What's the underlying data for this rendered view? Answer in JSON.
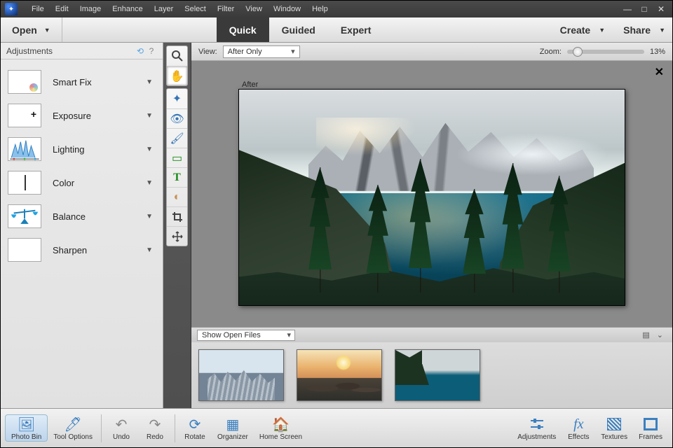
{
  "menu": {
    "items": [
      "File",
      "Edit",
      "Image",
      "Enhance",
      "Layer",
      "Select",
      "Filter",
      "View",
      "Window",
      "Help"
    ]
  },
  "topbar": {
    "open_label": "Open",
    "modes": {
      "quick": "Quick",
      "guided": "Guided",
      "expert": "Expert"
    },
    "create_label": "Create",
    "share_label": "Share"
  },
  "adjustments": {
    "title": "Adjustments",
    "items": [
      {
        "label": "Smart Fix"
      },
      {
        "label": "Exposure"
      },
      {
        "label": "Lighting"
      },
      {
        "label": "Color"
      },
      {
        "label": "Balance"
      },
      {
        "label": "Sharpen"
      }
    ]
  },
  "tools": {
    "names": [
      "zoom",
      "hand",
      "quick-select",
      "eye",
      "whiten",
      "spot-heal",
      "redeye",
      "text",
      "straighten",
      "crop",
      "move"
    ]
  },
  "viewbar": {
    "view_label": "View:",
    "view_value": "After Only",
    "zoom_label": "Zoom:",
    "zoom_value": "13%"
  },
  "canvas": {
    "after_label": "After"
  },
  "bin": {
    "dropdown": "Show Open Files"
  },
  "bottom": {
    "photo_bin": "Photo Bin",
    "tool_options": "Tool Options",
    "undo": "Undo",
    "redo": "Redo",
    "rotate": "Rotate",
    "organizer": "Organizer",
    "home": "Home Screen",
    "adjustments": "Adjustments",
    "effects": "Effects",
    "textures": "Textures",
    "frames": "Frames"
  }
}
